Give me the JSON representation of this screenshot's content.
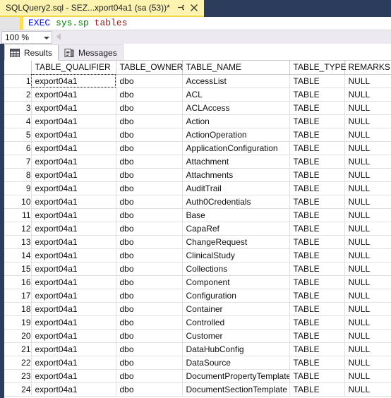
{
  "window": {
    "tab_title": "SQLQuery2.sql - SEZ...xport04a1 (sa (53))*",
    "pin_icon": "pin-icon",
    "close_icon": "close-icon"
  },
  "editor": {
    "query_keyword": "EXEC",
    "query_schema": "sys.sp",
    "query_object": "tables",
    "zoom_level": "100 %"
  },
  "result_tabs": [
    {
      "label": "Results",
      "icon": "grid-icon",
      "active": true
    },
    {
      "label": "Messages",
      "icon": "message-document-icon",
      "active": false
    }
  ],
  "grid": {
    "columns": [
      "TABLE_QUALIFIER",
      "TABLE_OWNER",
      "TABLE_NAME",
      "TABLE_TYPE",
      "REMARKS"
    ],
    "selected_cell": {
      "row": 1,
      "column": "TABLE_QUALIFIER"
    },
    "rows": [
      {
        "n": "1",
        "qualifier": "export04a1",
        "owner": "dbo",
        "name": "AccessList",
        "type": "TABLE",
        "remarks": "NULL"
      },
      {
        "n": "2",
        "qualifier": "export04a1",
        "owner": "dbo",
        "name": "ACL",
        "type": "TABLE",
        "remarks": "NULL"
      },
      {
        "n": "3",
        "qualifier": "export04a1",
        "owner": "dbo",
        "name": "ACLAccess",
        "type": "TABLE",
        "remarks": "NULL"
      },
      {
        "n": "4",
        "qualifier": "export04a1",
        "owner": "dbo",
        "name": "Action",
        "type": "TABLE",
        "remarks": "NULL"
      },
      {
        "n": "5",
        "qualifier": "export04a1",
        "owner": "dbo",
        "name": "ActionOperation",
        "type": "TABLE",
        "remarks": "NULL"
      },
      {
        "n": "6",
        "qualifier": "export04a1",
        "owner": "dbo",
        "name": "ApplicationConfiguration",
        "type": "TABLE",
        "remarks": "NULL"
      },
      {
        "n": "7",
        "qualifier": "export04a1",
        "owner": "dbo",
        "name": "Attachment",
        "type": "TABLE",
        "remarks": "NULL"
      },
      {
        "n": "8",
        "qualifier": "export04a1",
        "owner": "dbo",
        "name": "Attachments",
        "type": "TABLE",
        "remarks": "NULL"
      },
      {
        "n": "9",
        "qualifier": "export04a1",
        "owner": "dbo",
        "name": "AuditTrail",
        "type": "TABLE",
        "remarks": "NULL"
      },
      {
        "n": "10",
        "qualifier": "export04a1",
        "owner": "dbo",
        "name": "Auth0Credentials",
        "type": "TABLE",
        "remarks": "NULL"
      },
      {
        "n": "11",
        "qualifier": "export04a1",
        "owner": "dbo",
        "name": "Base",
        "type": "TABLE",
        "remarks": "NULL"
      },
      {
        "n": "12",
        "qualifier": "export04a1",
        "owner": "dbo",
        "name": "CapaRef",
        "type": "TABLE",
        "remarks": "NULL"
      },
      {
        "n": "13",
        "qualifier": "export04a1",
        "owner": "dbo",
        "name": "ChangeRequest",
        "type": "TABLE",
        "remarks": "NULL"
      },
      {
        "n": "14",
        "qualifier": "export04a1",
        "owner": "dbo",
        "name": "ClinicalStudy",
        "type": "TABLE",
        "remarks": "NULL"
      },
      {
        "n": "15",
        "qualifier": "export04a1",
        "owner": "dbo",
        "name": "Collections",
        "type": "TABLE",
        "remarks": "NULL"
      },
      {
        "n": "16",
        "qualifier": "export04a1",
        "owner": "dbo",
        "name": "Component",
        "type": "TABLE",
        "remarks": "NULL"
      },
      {
        "n": "17",
        "qualifier": "export04a1",
        "owner": "dbo",
        "name": "Configuration",
        "type": "TABLE",
        "remarks": "NULL"
      },
      {
        "n": "18",
        "qualifier": "export04a1",
        "owner": "dbo",
        "name": "Container",
        "type": "TABLE",
        "remarks": "NULL"
      },
      {
        "n": "19",
        "qualifier": "export04a1",
        "owner": "dbo",
        "name": "Controlled",
        "type": "TABLE",
        "remarks": "NULL"
      },
      {
        "n": "20",
        "qualifier": "export04a1",
        "owner": "dbo",
        "name": "Customer",
        "type": "TABLE",
        "remarks": "NULL"
      },
      {
        "n": "21",
        "qualifier": "export04a1",
        "owner": "dbo",
        "name": "DataHubConfig",
        "type": "TABLE",
        "remarks": "NULL"
      },
      {
        "n": "22",
        "qualifier": "export04a1",
        "owner": "dbo",
        "name": "DataSource",
        "type": "TABLE",
        "remarks": "NULL"
      },
      {
        "n": "23",
        "qualifier": "export04a1",
        "owner": "dbo",
        "name": "DocumentPropertyTemplate",
        "type": "TABLE",
        "remarks": "NULL"
      },
      {
        "n": "24",
        "qualifier": "export04a1",
        "owner": "dbo",
        "name": "DocumentSectionTemplate",
        "type": "TABLE",
        "remarks": "NULL"
      }
    ]
  },
  "colors": {
    "chrome_navy": "#2b3c5c",
    "tab_yellow": "#fdf3b0",
    "tab_yellow_border": "#f0d849",
    "null_cell": "#fbfbe0",
    "keyword_blue": "#0000ff",
    "schema_green": "#008000",
    "proc_darkred": "#8b1a1a"
  }
}
